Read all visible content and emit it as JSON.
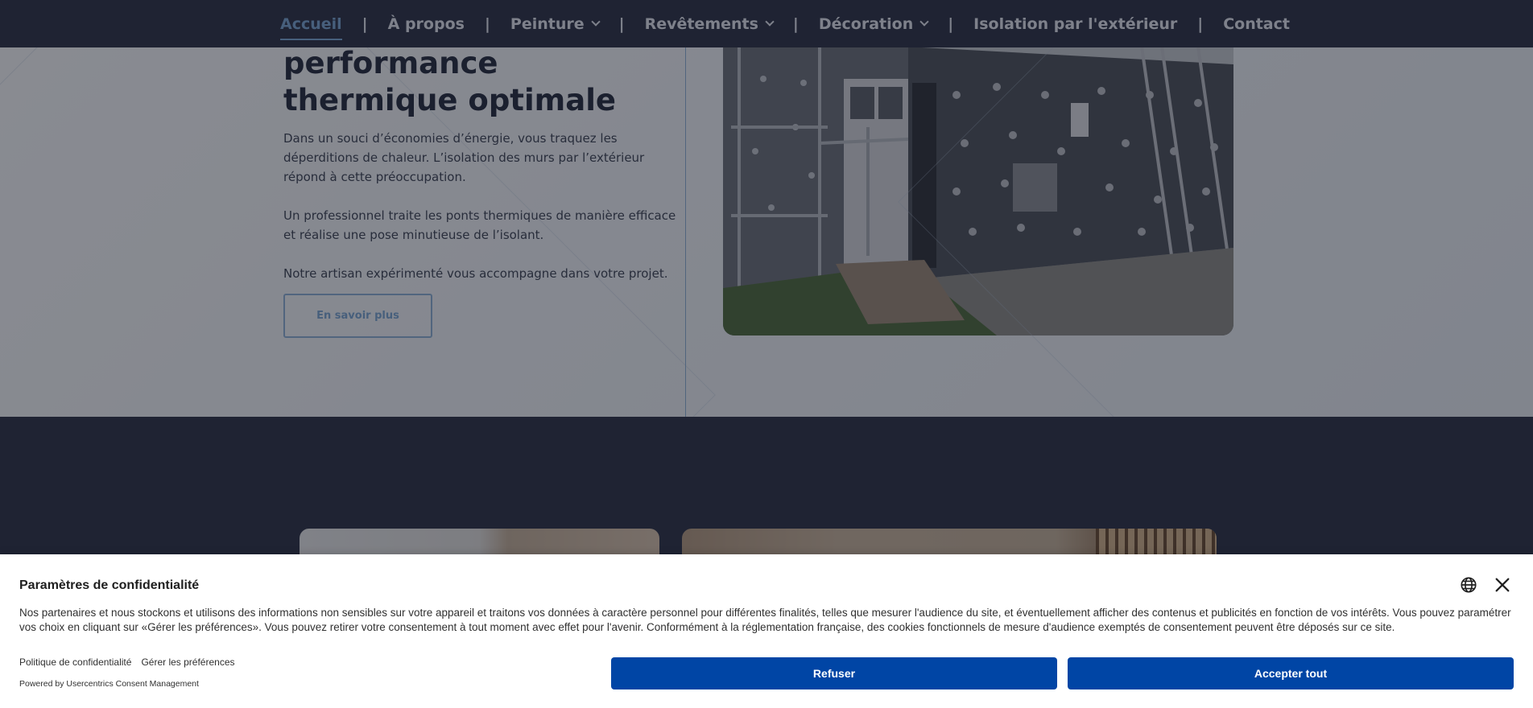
{
  "nav": {
    "items": [
      {
        "label": "Accueil",
        "active": true,
        "has_dropdown": false
      },
      {
        "label": "À propos",
        "active": false,
        "has_dropdown": false
      },
      {
        "label": "Peinture",
        "active": false,
        "has_dropdown": true
      },
      {
        "label": "Revêtements",
        "active": false,
        "has_dropdown": true
      },
      {
        "label": "Décoration",
        "active": false,
        "has_dropdown": true
      },
      {
        "label": "Isolation par l'extérieur",
        "active": false,
        "has_dropdown": false
      },
      {
        "label": "Contact",
        "active": false,
        "has_dropdown": false
      }
    ],
    "separator": "|"
  },
  "hero": {
    "heading_line1": "performance",
    "heading_line2": "thermique optimale",
    "paragraph1": "Dans un souci d’économies d’énergie, vous traquez les déperditions de chaleur. L’isolation des murs par l’extérieur répond à cette préoccupation.",
    "paragraph2": "Un professionnel traite les ponts thermiques de manière efficace et réalise une pose minutieuse de l’isolant.",
    "paragraph3": "Notre artisan expérimenté vous accompagne dans votre projet.",
    "cta_label": "En savoir plus",
    "photo_icon": "insulation-works-photo"
  },
  "consent": {
    "title": "Paramètres de confidentialité",
    "body": "Nos partenaires et nous stockons et utilisons des informations non sensibles sur votre appareil et traitons vos données à caractère personnel pour différentes finalités, telles que mesurer l'audience du site, et éventuellement afficher des contenus et publicités en fonction de vos intérêts. Vous pouvez paramétrer vos choix en cliquant sur «Gérer les préférences». Vous pouvez retirer votre consentement à tout moment avec effet pour l'avenir. Conformément à la réglementation française, des cookies fonctionnels de mesure d'audience exemptés de consentement peuvent être déposés sur ce site.",
    "privacy_link": "Politique de confidentialité",
    "preferences_link": "Gérer les préférences",
    "powered_by": "Powered by Usercentrics Consent Management",
    "refuse_label": "Refuser",
    "accept_label": "Accepter tout",
    "language_icon": "globe-icon",
    "close_icon": "close-icon"
  },
  "colors": {
    "nav_bg": "#2a2f42",
    "accent": "#7aa6d4",
    "consent_button": "#0045a5"
  }
}
